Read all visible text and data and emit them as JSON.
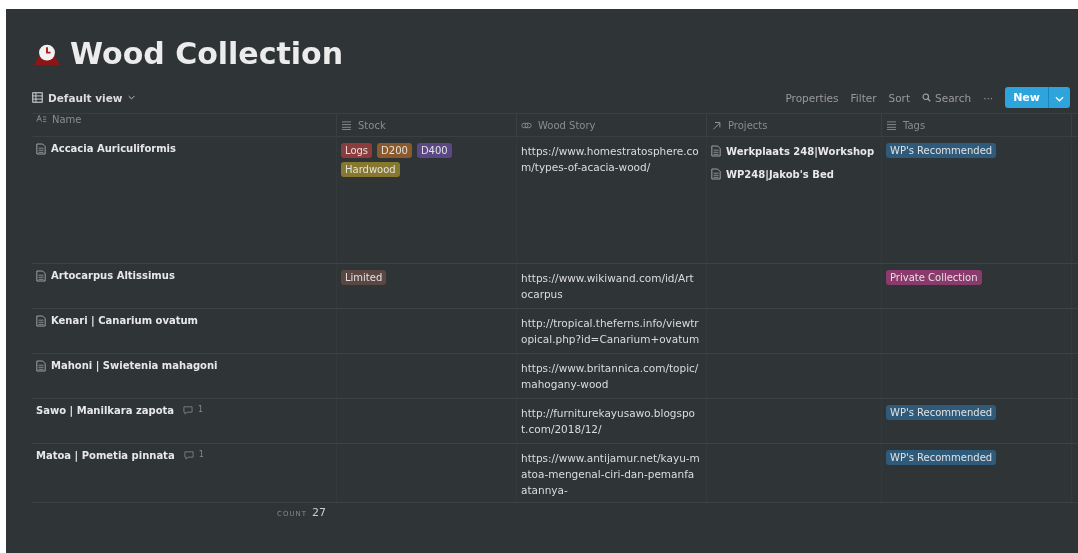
{
  "title": "Wood Collection",
  "view": {
    "label": "Default view"
  },
  "toolbar": [
    "Properties",
    "Filter",
    "Sort"
  ],
  "search": {
    "label": "Search"
  },
  "more": "···",
  "new_button": {
    "label": "New"
  },
  "columns": [
    {
      "label": "Name",
      "kind": "title"
    },
    {
      "label": "Stock",
      "kind": "multi"
    },
    {
      "label": "Wood Story",
      "kind": "url"
    },
    {
      "label": "Projects",
      "kind": "relation"
    },
    {
      "label": "Tags",
      "kind": "multi"
    }
  ],
  "rows": [
    {
      "name": "Accacia Auriculiformis",
      "page_icon": true,
      "stock": [
        {
          "label": "Logs",
          "color": "#8b3c3c"
        },
        {
          "label": "D200",
          "color": "#8a5a2c"
        },
        {
          "label": "D400",
          "color": "#5c4785"
        },
        {
          "label": "Hardwood",
          "color": "#86782c"
        }
      ],
      "story": "https://www.homestratosphere.com/types-of-acacia-wood/",
      "projects": [
        "Werkplaats 248|Workshop",
        "WP248|Jakob's Bed"
      ],
      "tags": [
        {
          "label": "WP's Recommended",
          "color": "#2f5a79"
        }
      ]
    },
    {
      "name": "Artocarpus Altissimus",
      "page_icon": true,
      "stock": [
        {
          "label": "Limited",
          "color": "#5a4642"
        }
      ],
      "story": "https://www.wikiwand.com/id/Artocarpus",
      "tags": [
        {
          "label": "Private Collection",
          "color": "#8a3a6c"
        }
      ]
    },
    {
      "name": "Kenari | Canarium ovatum",
      "page_icon": true,
      "story": "http://tropical.theferns.info/viewtropical.php?id=Canarium+ovatum"
    },
    {
      "name": "Mahoni | Swietenia mahagoni",
      "page_icon": true,
      "story": "https://www.britannica.com/topic/mahogany-wood"
    },
    {
      "name": "Sawo | Manilkara zapota",
      "page_icon": false,
      "comments": "1",
      "story": "http://furniturekayusawo.blogspot.com/2018/12/",
      "tags": [
        {
          "label": "WP's Recommended",
          "color": "#2f5a79"
        }
      ]
    },
    {
      "name": "Matoa | Pometia pinnata",
      "page_icon": false,
      "comments": "1",
      "story": "https://www.antijamur.net/kayu-matoa-mengenal-ciri-dan-pemanfaatannya-",
      "tags": [
        {
          "label": "WP's Recommended",
          "color": "#2f5a79"
        }
      ]
    }
  ],
  "footer": {
    "label": "COUNT",
    "value": "27"
  }
}
